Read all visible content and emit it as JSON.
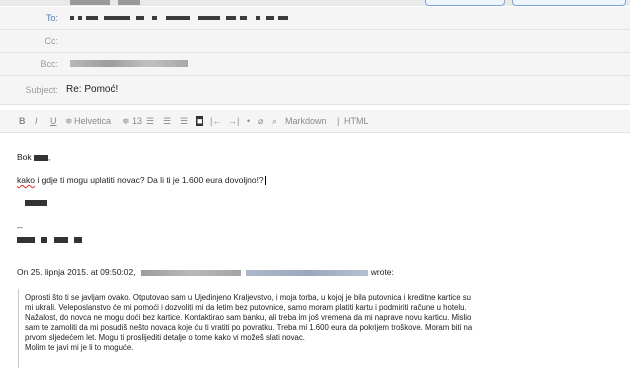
{
  "header": {
    "to_label": "To:",
    "cc_label": "Cc:",
    "bcc_label": "Bcc:",
    "subject_label": "Subject:",
    "subject_value": "Re: Pomoć!"
  },
  "toolbar": {
    "bold": "B",
    "italic": "I",
    "underline": "U",
    "font_stepper": "≑",
    "font": "Helvetica",
    "size_stepper": "≑",
    "size": "13",
    "markdown": "Markdown",
    "separator": "|",
    "html": "HTML"
  },
  "body": {
    "greeting_prefix": "Bok",
    "greeting_suffix": ",",
    "line1_word1": "kako",
    "line1_rest": " i gdje ti mogu uplatiti novac? Da li ti je 1.600 eura dovoljno!?",
    "sig_dashes": "--",
    "on_prefix": "On 25. lipnja 2015. at 09:50:02,",
    "on_suffix": "wrote:"
  },
  "quote": {
    "lines": [
      "Oprosti što ti se javljam ovako. Otputovao sam u Ujedinjeno Kraljevstvo, i moja torba, u kojoj je bila putovnica i kreditne kartice su",
      "mi ukrali. Veleposlanstvo će mi pomoći i dozvoliti mi da letim bez putovnice, samo moram platiti kartu i podmiriti račune u hotelu.",
      "Nažalost, do novca ne mogu doći bez kartice. Kontaktirao sam banku, ali treba im još vremena da mi naprave novu karticu. Mislio",
      "sam te zamoliti da mi posudiš nešto novaca koje ću ti vratiti po povratku. Treba mi 1.600 eura da pokrijem troškove. Moram biti na",
      "prvom sljedećem let. Mogu ti proslijediti detalje o tome kako vi možeš slati novac.",
      "Molim te javi mi je li to moguće."
    ]
  }
}
